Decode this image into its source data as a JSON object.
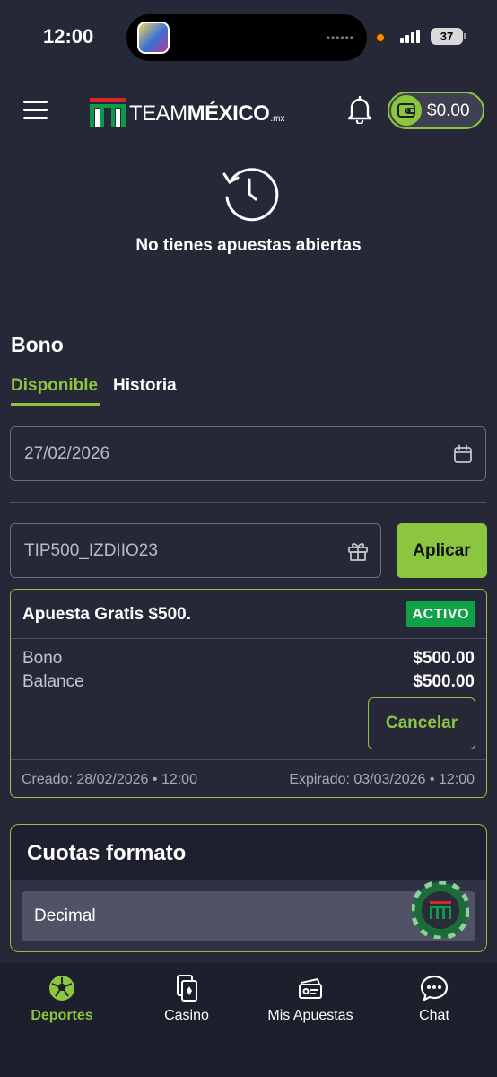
{
  "status_bar": {
    "time": "12:00",
    "battery": "37"
  },
  "header": {
    "logo_team": "TEAM",
    "logo_mexico": "MÉXICO",
    "logo_mx": ".mx",
    "balance": "$0.00"
  },
  "empty_state": {
    "message": "No tienes apuestas abiertas"
  },
  "bono": {
    "title": "Bono",
    "tabs": [
      {
        "label": "Disponible",
        "active": true
      },
      {
        "label": "Historia",
        "active": false
      }
    ],
    "date_value": "27/02/2026",
    "code_value": "TIP500_IZDIIO23",
    "apply_label": "Aplicar",
    "card": {
      "name": "Apuesta Gratis $500.",
      "status": "ACTIVO",
      "rows": [
        {
          "label": "Bono",
          "value": "$500.00"
        },
        {
          "label": "Balance",
          "value": "$500.00"
        }
      ],
      "cancel_label": "Cancelar",
      "created": "Creado: 28/02/2026 • 12:00",
      "expired": "Expirado: 03/03/2026 • 12:00"
    }
  },
  "odds_format": {
    "title": "Cuotas formato",
    "selected": "Decimal"
  },
  "bottom_nav": [
    {
      "label": "Deportes",
      "icon": "soccer-ball-icon",
      "active": true
    },
    {
      "label": "Casino",
      "icon": "playing-cards-icon",
      "active": false
    },
    {
      "label": "Mis Apuestas",
      "icon": "bet-ticket-icon",
      "active": false
    },
    {
      "label": "Chat",
      "icon": "chat-bubble-icon",
      "active": false
    }
  ],
  "colors": {
    "accent": "#8cc63f",
    "background": "#262838",
    "active_badge": "#0fa145"
  }
}
